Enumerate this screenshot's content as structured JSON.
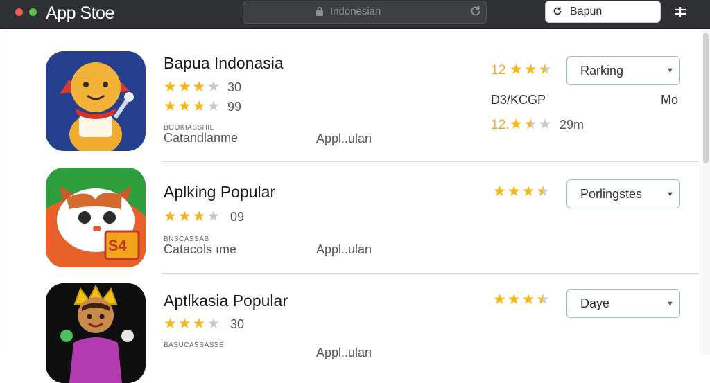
{
  "window": {
    "title": "App Stoe",
    "url": "Indonesian",
    "search_value": "Bapun"
  },
  "apps": [
    {
      "name": "Bapua Indonasia",
      "rating_a": "30",
      "rating_b": "99",
      "subtitle": "BOOKIASSHIL",
      "category": "Catandlanme",
      "type": "Appl..ulan",
      "right_rating": "12",
      "select_label": "Rarking",
      "meta_left": "D3/KCGP",
      "meta_right": "Mo",
      "size_rating": "12.",
      "size": "29m"
    },
    {
      "name": "Aplking Popular",
      "rating_a": "09",
      "subtitle": "BNSCASSAB",
      "category": "Catacols ıme",
      "type": "Appl..ulan",
      "select_label": "Porlingstes",
      "badge": "S4"
    },
    {
      "name": "Aptlkasia Popular",
      "rating_a": "30",
      "subtitle": "BASUCASSASSE",
      "type": "Appl..ulan",
      "select_label": "Daye"
    }
  ],
  "colors": {
    "accent_star": "#f5b51b",
    "rating_text": "#f5a623",
    "titlebar": "#2f3033",
    "select_border": "#9fb8d6"
  },
  "icons": [
    "lock-icon",
    "reload-icon",
    "search-icon",
    "menu-icon",
    "chevron-down-icon"
  ]
}
